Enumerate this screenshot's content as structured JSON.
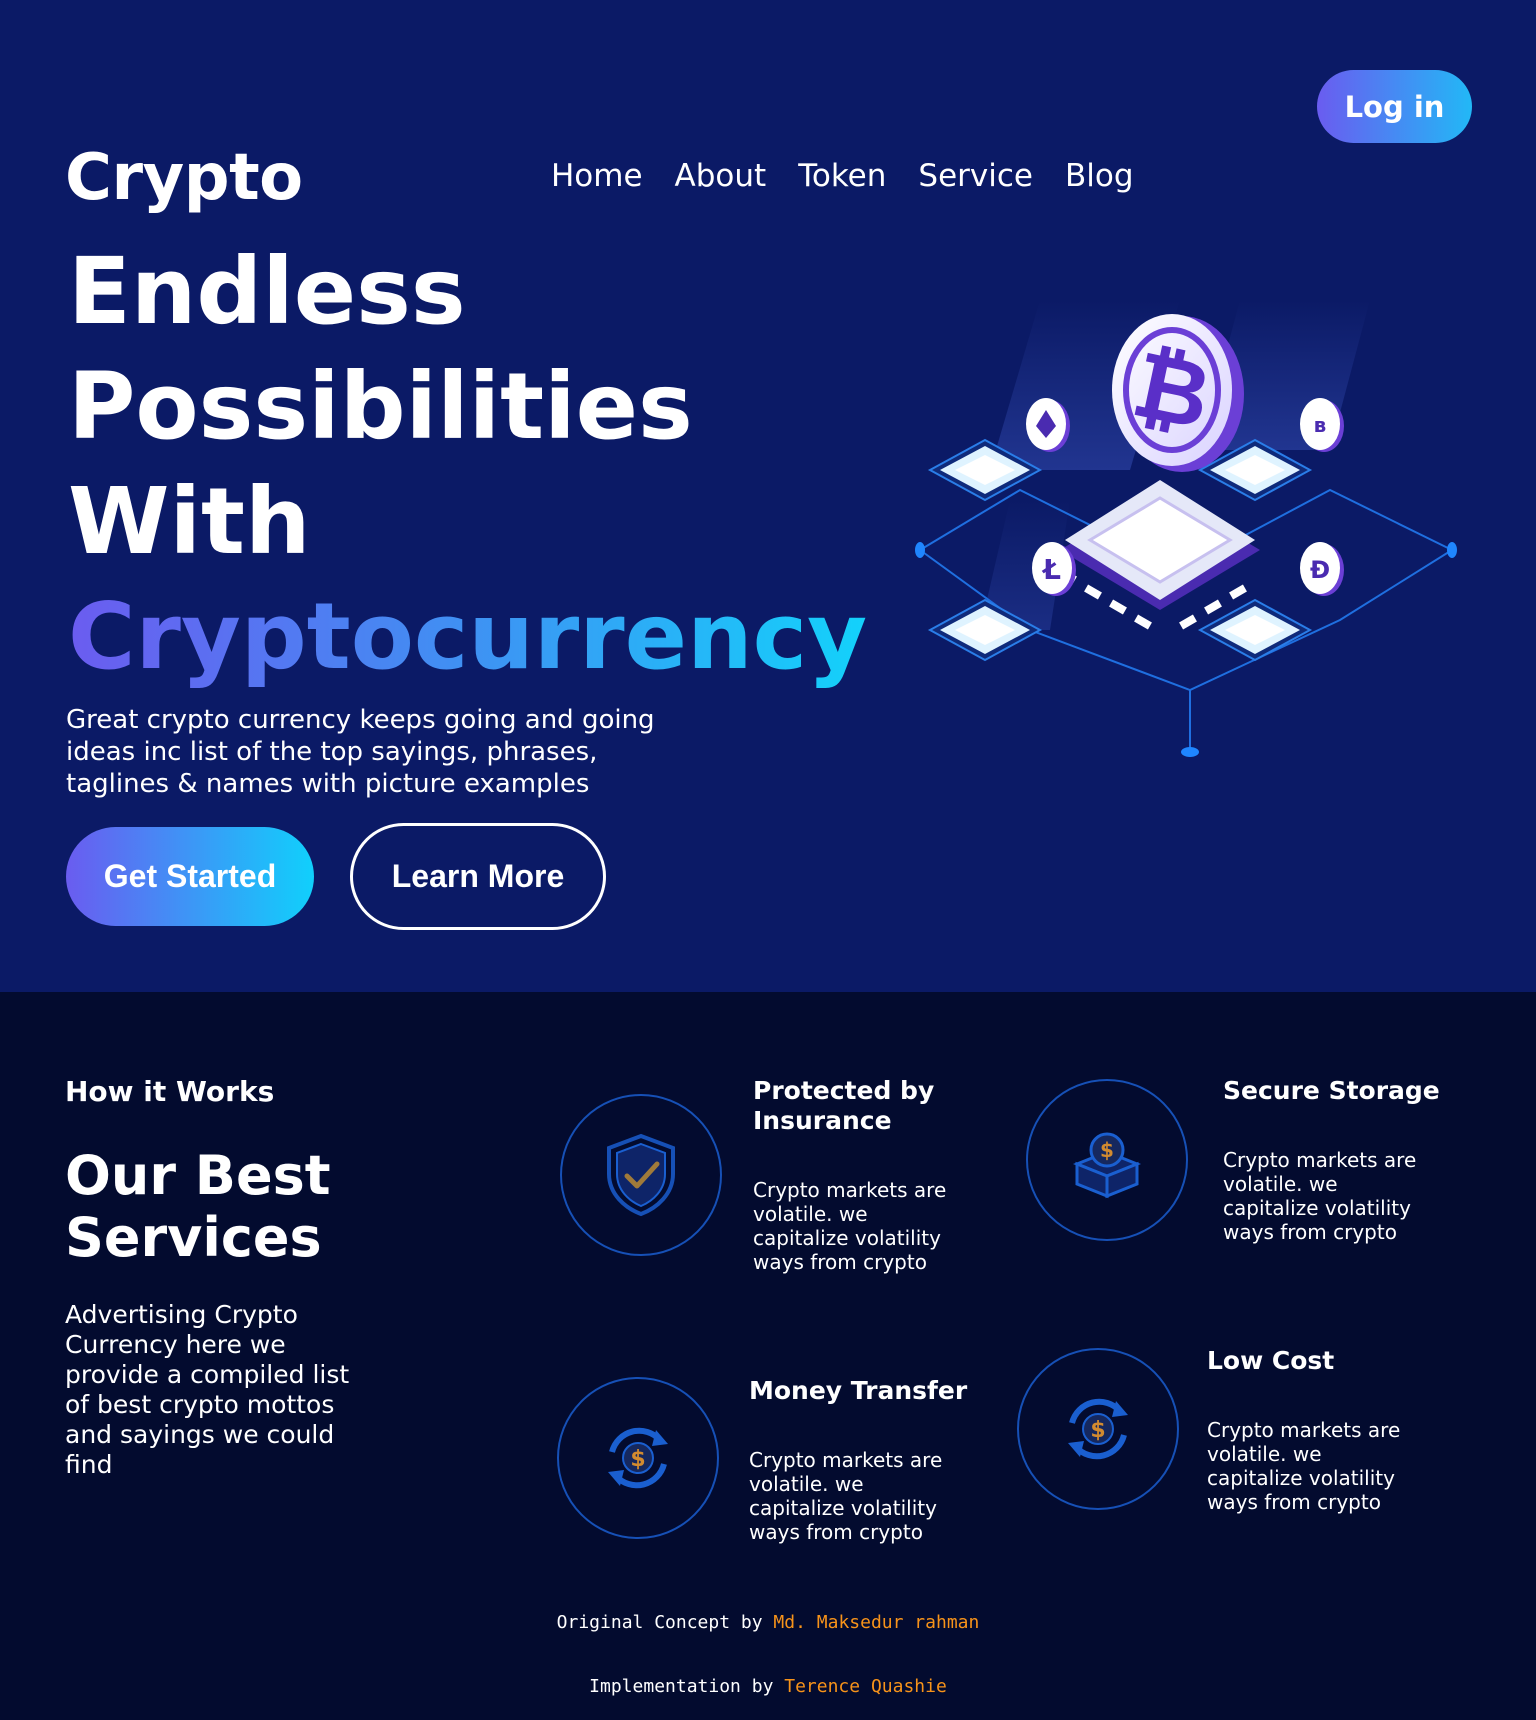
{
  "header": {
    "logo": "Crypto",
    "login_label": "Log in",
    "nav": [
      {
        "label": "Home"
      },
      {
        "label": "About"
      },
      {
        "label": "Token"
      },
      {
        "label": "Service"
      },
      {
        "label": "Blog"
      }
    ]
  },
  "hero": {
    "headline_lines": [
      "Endless",
      "Possibilities",
      "With"
    ],
    "headline_highlight": "Cryptocurrency",
    "tagline": "Great crypto currency keeps going and going ideas inc list of the top sayings, phrases, taglines & names with picture examples",
    "primary_cta": "Get Started",
    "secondary_cta": "Learn More",
    "illustration_icons": [
      "bitcoin-icon",
      "ethereum-icon",
      "litecoin-icon",
      "dash-icon",
      "coin-icon"
    ]
  },
  "services": {
    "eyebrow": "How it Works",
    "title": "Our Best Services",
    "description": "Advertising Crypto Currency here we provide a compiled list of best crypto mottos and sayings we could find",
    "cards": [
      {
        "title": "Protected by Insurance",
        "text": "Crypto markets are volatile. we capitalize volatility ways from crypto",
        "icon": "shield-check-icon"
      },
      {
        "title": "Secure Storage",
        "text": "Crypto markets are volatile. we capitalize volatility ways from crypto",
        "icon": "coin-box-icon"
      },
      {
        "title": "Money Transfer",
        "text": "Crypto markets are volatile. we capitalize volatility ways from crypto",
        "icon": "dollar-exchange-icon"
      },
      {
        "title": "Low Cost",
        "text": "Crypto markets are volatile. we capitalize volatility ways from crypto",
        "icon": "dollar-exchange-icon"
      }
    ]
  },
  "footer": {
    "concept_prefix": "Original Concept by",
    "concept_name": "Md. Maksedur rahman",
    "impl_prefix": "Implementation by",
    "impl_name": "Terence Quashie"
  },
  "colors": {
    "hero_bg": "#0b1a66",
    "services_bg": "#030b2f",
    "accent_start": "#6a5cf0",
    "accent_end": "#13d2fb",
    "footer_name": "#f7931a",
    "icon_ring": "#1650b6"
  }
}
